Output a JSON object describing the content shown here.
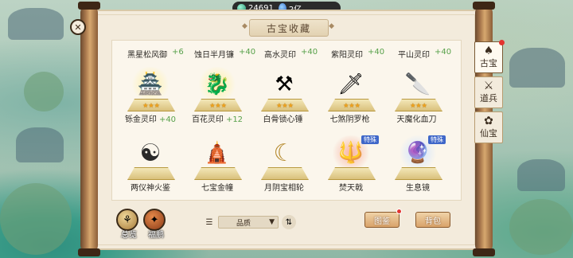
{
  "resources": {
    "jade": "24691",
    "spirit": "2亿"
  },
  "title": "古宝收藏",
  "previous_row": [
    {
      "name": "黑星松风御",
      "bonus": "+6"
    },
    {
      "name": "蚀日半月镰",
      "bonus": "+40"
    },
    {
      "name": "高水灵印",
      "bonus": "+40"
    },
    {
      "name": "紫阳灵印",
      "bonus": "+40"
    },
    {
      "name": "平山灵印",
      "bonus": "+40"
    }
  ],
  "items": [
    {
      "name": "铄金灵印",
      "bonus": "+40",
      "stars": "★★★",
      "icon": "seal-icon",
      "glyph": "🏯",
      "tag": ""
    },
    {
      "name": "百花灵印",
      "bonus": "+12",
      "stars": "★★★",
      "icon": "seal-icon",
      "glyph": "🐉",
      "tag": ""
    },
    {
      "name": "白骨锁心锤",
      "bonus": "",
      "stars": "★★★",
      "icon": "hammer-icon",
      "glyph": "⚒",
      "tag": ""
    },
    {
      "name": "七煞阴罗枪",
      "bonus": "",
      "stars": "★★★",
      "icon": "spear-icon",
      "glyph": "🗡",
      "tag": ""
    },
    {
      "name": "天魔化血刀",
      "bonus": "",
      "stars": "★★★",
      "icon": "blade-icon",
      "glyph": "🔪",
      "tag": ""
    },
    {
      "name": "两仪神火鉴",
      "bonus": "",
      "stars": "",
      "icon": "yinyang-mirror-icon",
      "glyph": "☯",
      "tag": ""
    },
    {
      "name": "七宝金幢",
      "bonus": "",
      "stars": "",
      "icon": "pagoda-icon",
      "glyph": "🛕",
      "tag": ""
    },
    {
      "name": "月阴宝相轮",
      "bonus": "",
      "stars": "",
      "icon": "moon-wheel-icon",
      "glyph": "☾",
      "tag": ""
    },
    {
      "name": "焚天戟",
      "bonus": "",
      "stars": "",
      "icon": "halberd-icon",
      "glyph": "🔱",
      "tag": "特殊"
    },
    {
      "name": "生息镜",
      "bonus": "",
      "stars": "",
      "icon": "mirror-icon",
      "glyph": "🔮",
      "tag": "特殊"
    }
  ],
  "tabs": [
    {
      "label": "古宝",
      "icon": "relic-icon",
      "glyph": "♠"
    },
    {
      "label": "道兵",
      "icon": "weapon-icon",
      "glyph": "⚔"
    },
    {
      "label": "仙宝",
      "icon": "treasure-icon",
      "glyph": "✿"
    }
  ],
  "bottom": {
    "overview_label": "总览",
    "tribute_label": "福鹏",
    "filter_value": "品质",
    "illustrate_label": "图鉴",
    "bag_label": "背包"
  },
  "colors": {
    "accent_green": "#58a14b",
    "star": "#f1a21a",
    "special_tag": "#3f67c9",
    "paper": "#f3ebdc"
  }
}
